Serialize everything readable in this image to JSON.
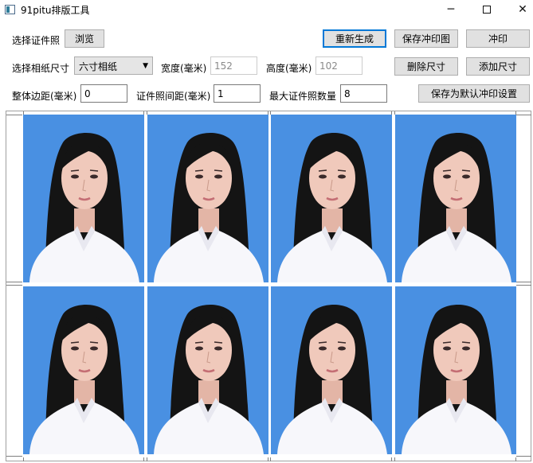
{
  "window": {
    "title": "91pitu排版工具",
    "controls": {
      "minimize": "─",
      "close": "✕"
    }
  },
  "row1": {
    "select_photo_label": "选择证件照",
    "browse_button": "浏览",
    "regenerate_button": "重新生成",
    "save_print_image_button": "保存冲印图",
    "print_button": "冲印"
  },
  "row2": {
    "paper_size_label": "选择相纸尺寸",
    "paper_size_value": "六寸相纸",
    "width_label": "宽度(毫米)",
    "width_value": "152",
    "height_label": "高度(毫米)",
    "height_value": "102",
    "delete_size_button": "删除尺寸",
    "add_size_button": "添加尺寸"
  },
  "row3": {
    "margin_label": "整体边距(毫米)",
    "margin_value": "0",
    "spacing_label": "证件照间距(毫米)",
    "spacing_value": "1",
    "max_count_label": "最大证件照数量",
    "max_count_value": "8",
    "save_default_button": "保存为默认冲印设置"
  },
  "layout_preview": {
    "rows": 2,
    "columns": 4,
    "photo_count": 8,
    "photo_background": "#4990e2"
  }
}
